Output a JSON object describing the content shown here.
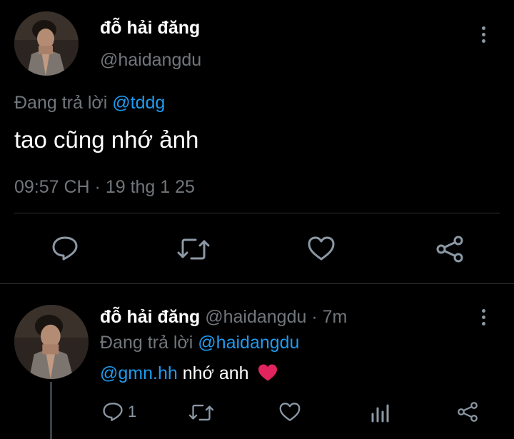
{
  "main_tweet": {
    "author_name": "đỗ hải đăng",
    "author_handle": "@haidangdu",
    "replying_prefix": "Đang trả lời",
    "replying_to": "@tddg",
    "text": "tao cũng nhớ ảnh",
    "timestamp": "09:57 CH · 19 thg 1 25",
    "icons": [
      "reply-icon",
      "retweet-icon",
      "like-icon",
      "share-icon"
    ]
  },
  "reply_tweet": {
    "author_name": "đỗ hải đăng",
    "author_handle": "@haidangdu",
    "dot": "·",
    "time": "7m",
    "replying_prefix": "Đang trả lời",
    "replying_to": "@haidangdu",
    "mention": "@gmn.hh",
    "text": "nhớ anh",
    "emoji": "❤️",
    "reply_count": "1",
    "icons": [
      "reply-icon",
      "retweet-icon",
      "like-icon",
      "analytics-icon",
      "share-icon"
    ]
  },
  "colors": {
    "background": "#000000",
    "link": "#1d9bf0",
    "muted": "#71767b",
    "divider": "#2f3336",
    "heart": "#e0245e"
  }
}
